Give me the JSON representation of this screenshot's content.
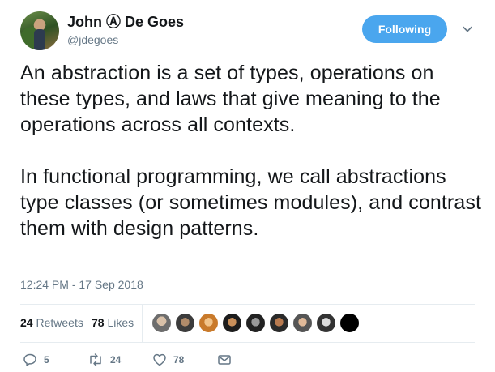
{
  "author": {
    "display_name": "John Ⓐ De Goes",
    "handle": "@jdegoes"
  },
  "follow_button": {
    "label": "Following"
  },
  "tweet": {
    "paragraphs": [
      "An abstraction is a set of types, operations on these types, and laws that give meaning to the operations across all contexts.",
      "In functional programming, we call abstractions type classes (or sometimes modules), and contrast them with design patterns."
    ],
    "timestamp": "12:24 PM - 17 Sep 2018"
  },
  "stats": {
    "retweets_count": "24",
    "retweets_label": "Retweets",
    "likes_count": "78",
    "likes_label": "Likes"
  },
  "actions": {
    "reply_count": "5",
    "retweet_count": "24",
    "like_count": "78"
  },
  "colors": {
    "accent": "#4aa6ee",
    "secondary_text": "#657786",
    "primary_text": "#14171a",
    "divider": "#e6ecf0"
  },
  "icons": {
    "reply": "reply-icon",
    "retweet": "retweet-icon",
    "like": "heart-icon",
    "dm": "envelope-icon",
    "menu": "chevron-down-icon"
  }
}
